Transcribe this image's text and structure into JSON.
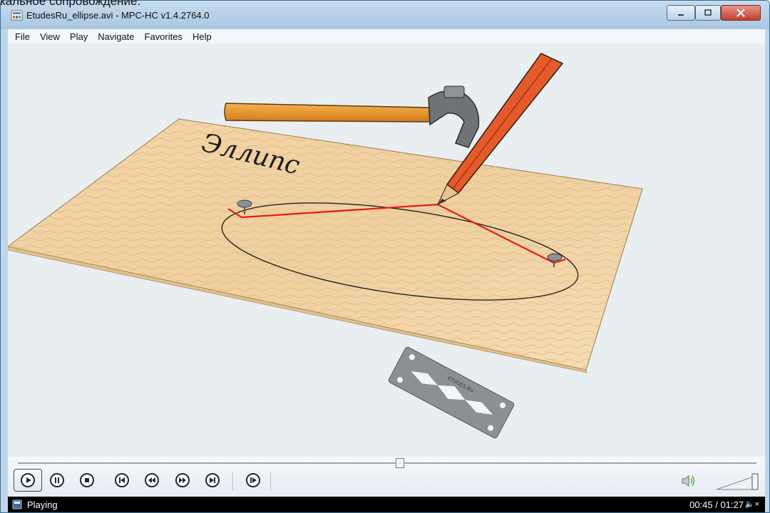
{
  "cutoff_text": "кальное сопровождение.",
  "window": {
    "title": "EtudesRu_ellipse.avi - MPC-HC v1.4.2764.0"
  },
  "menu": [
    "File",
    "View",
    "Play",
    "Navigate",
    "Favorites",
    "Help"
  ],
  "video": {
    "caption": "Эллипс",
    "blade_text": "ETUDES.RU"
  },
  "seek": {
    "position_fraction": 0.52
  },
  "controls": {
    "buttons": [
      "play-icon",
      "pause-icon",
      "stop-icon",
      "skip-back-icon",
      "rewind-icon",
      "fast-forward-icon",
      "skip-forward-icon",
      "frame-step-icon"
    ]
  },
  "volume": {
    "level_fraction": 1.0,
    "icon": "speaker-icon"
  },
  "status": {
    "text": "Playing",
    "time": "00:45 / 01:27",
    "speaker_symbol": "🔈×"
  },
  "colors": {
    "titlebar": "#b8d0e8",
    "close_button": "#c2402d",
    "board": "#f2d3a3",
    "string": "#e21d12",
    "pencil": "#e55a2b"
  }
}
